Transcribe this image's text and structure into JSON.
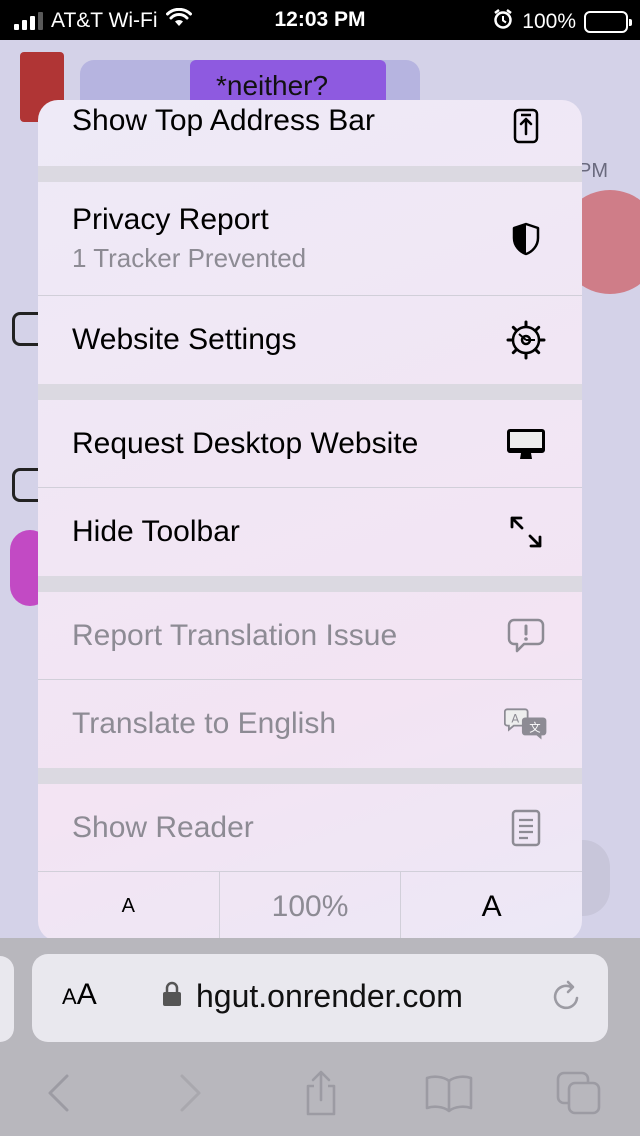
{
  "status_bar": {
    "carrier": "AT&T Wi-Fi",
    "time": "12:03 PM",
    "battery_percent": "100%",
    "icons": [
      "signal-icon",
      "wifi-icon",
      "alarm-icon",
      "battery-icon"
    ]
  },
  "background_page": {
    "tag_text": "*neither?",
    "time_fragment": "PM"
  },
  "menu": {
    "items": [
      {
        "label": "Show Top Address Bar",
        "icon": "top-address-bar-icon",
        "enabled": true
      },
      {
        "label": "Privacy Report",
        "sublabel": "1 Tracker Prevented",
        "icon": "shield-icon",
        "enabled": true
      },
      {
        "label": "Website Settings",
        "icon": "gear-icon",
        "enabled": true
      },
      {
        "label": "Request Desktop Website",
        "icon": "desktop-icon",
        "enabled": true
      },
      {
        "label": "Hide Toolbar",
        "icon": "expand-arrows-icon",
        "enabled": true
      },
      {
        "label": "Report Translation Issue",
        "icon": "report-bubble-icon",
        "enabled": false
      },
      {
        "label": "Translate to English",
        "icon": "translate-icon",
        "enabled": false
      },
      {
        "label": "Show Reader",
        "icon": "reader-icon",
        "enabled": false
      }
    ],
    "font_size": {
      "smaller_label": "A",
      "zoom": "100%",
      "larger_label": "A"
    }
  },
  "toolbar": {
    "aa_small": "A",
    "aa_large": "A",
    "url": "hgut.onrender.com",
    "icons": [
      "lock-icon",
      "reload-icon",
      "back-icon",
      "forward-icon",
      "share-icon",
      "bookmarks-icon",
      "tabs-icon"
    ],
    "back_enabled": false,
    "forward_enabled": false
  },
  "colors": {
    "accent_battery": "#f8d10b",
    "menu_text": "#000000",
    "menu_text_disabled": "#8d8b94"
  }
}
